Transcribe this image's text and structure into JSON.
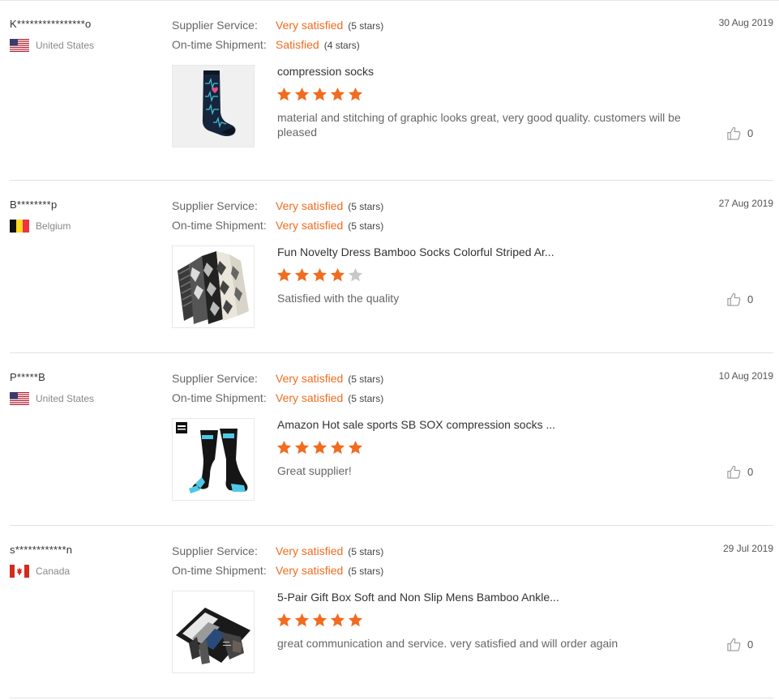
{
  "labels": {
    "supplier_service": "Supplier Service:",
    "shipment": "On-time Shipment:"
  },
  "colors": {
    "accent": "#f06c1f",
    "star_empty": "#c8c8c8"
  },
  "reviews": [
    {
      "buyer": "K****************o",
      "country": "United States",
      "flag": "us",
      "date": "30 Aug 2019",
      "supplier_service": {
        "rating": "Very satisfied",
        "stars": "(5 stars)"
      },
      "shipment": {
        "rating": "Satisfied",
        "stars": "(4 stars)"
      },
      "product": "compression socks",
      "product_image": "navy-heartbeat-compression-sock",
      "rating": 5,
      "comment": "material and stitching of graphic looks great, very good quality. customers will be pleased",
      "likes": "0"
    },
    {
      "buyer": "B********p",
      "country": "Belgium",
      "flag": "be",
      "date": "27 Aug 2019",
      "supplier_service": {
        "rating": "Very satisfied",
        "stars": "(5 stars)"
      },
      "shipment": {
        "rating": "Very satisfied",
        "stars": "(5 stars)"
      },
      "product": "Fun Novelty Dress Bamboo Socks Colorful Striped Ar...",
      "product_image": "argyle-dress-socks",
      "rating": 4,
      "comment": "Satisfied with the quality",
      "likes": "0"
    },
    {
      "buyer": "P*****B",
      "country": "United States",
      "flag": "us",
      "date": "10 Aug 2019",
      "supplier_service": {
        "rating": "Very satisfied",
        "stars": "(5 stars)"
      },
      "shipment": {
        "rating": "Very satisfied",
        "stars": "(5 stars)"
      },
      "product": "Amazon Hot sale sports SB SOX compression socks ...",
      "product_image": "black-blue-compression-socks",
      "rating": 5,
      "comment": "Great supplier!",
      "likes": "0"
    },
    {
      "buyer": "s************n",
      "country": "Canada",
      "flag": "ca",
      "date": "29 Jul 2019",
      "supplier_service": {
        "rating": "Very satisfied",
        "stars": "(5 stars)"
      },
      "shipment": {
        "rating": "Very satisfied",
        "stars": "(5 stars)"
      },
      "product": "5-Pair Gift Box Soft and Non Slip Mens Bamboo Ankle...",
      "product_image": "bamboo-socks-gift-box",
      "rating": 5,
      "comment": "great communication and service.  very satisfied and will order again",
      "likes": "0"
    }
  ]
}
